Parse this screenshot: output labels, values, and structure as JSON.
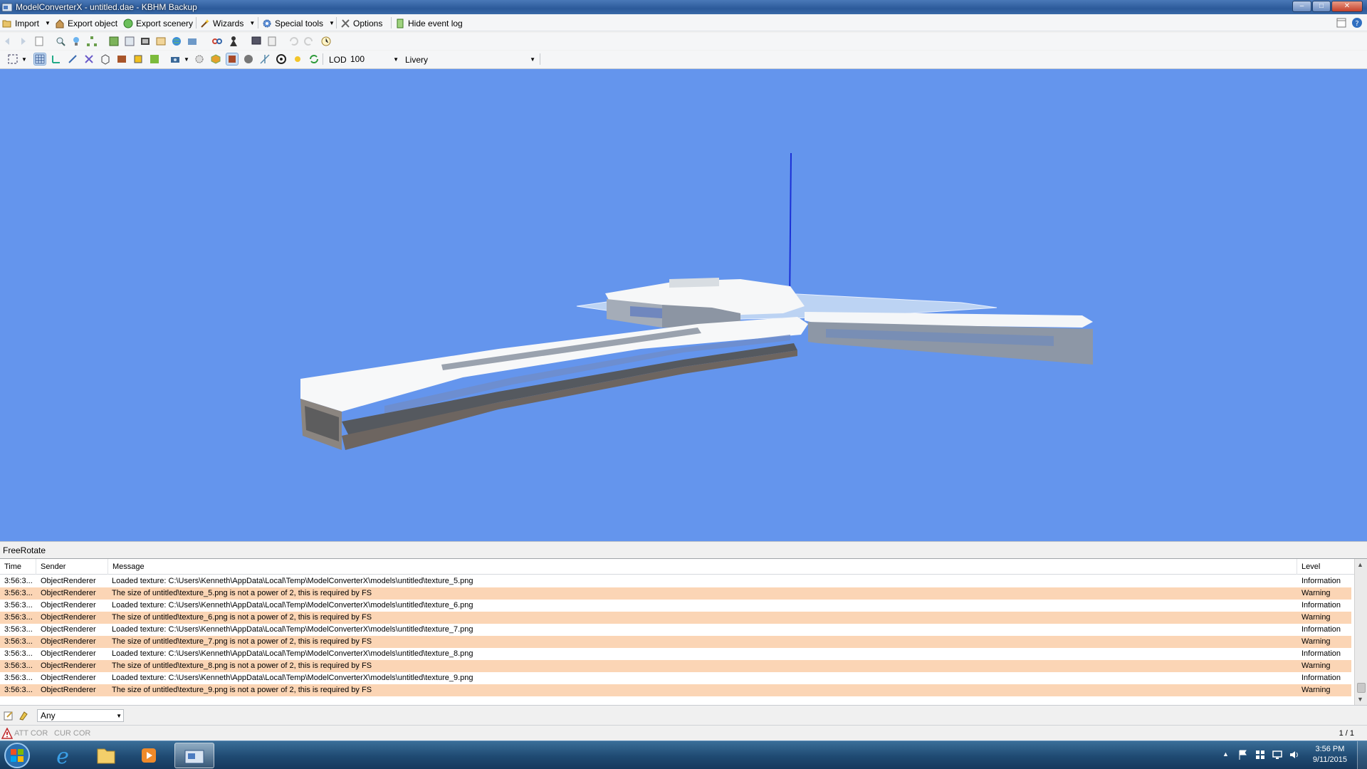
{
  "window": {
    "title": "ModelConverterX - untitled.dae - KBHM Backup",
    "buttons": {
      "minimize": "–",
      "maximize": "□",
      "close": "✕"
    }
  },
  "menu": {
    "import": "Import",
    "export_object": "Export object",
    "export_scenery": "Export scenery",
    "wizards": "Wizards",
    "special_tools": "Special tools",
    "options": "Options",
    "hide_event_log": "Hide event log"
  },
  "toolbar": {
    "lod_label": "LOD",
    "lod_value": "100",
    "livery_label": "Livery",
    "livery_value": ""
  },
  "viewport": {
    "mode": "FreeRotate",
    "background": "#6495ed"
  },
  "log": {
    "columns": {
      "time": "Time",
      "sender": "Sender",
      "message": "Message",
      "level": "Level"
    },
    "rows": [
      {
        "time": "3:56:3...",
        "sender": "ObjectRenderer",
        "message": "Loaded texture: C:\\Users\\Kenneth\\AppData\\Local\\Temp\\ModelConverterX\\models\\untitled\\texture_5.png",
        "level": "Information"
      },
      {
        "time": "3:56:3...",
        "sender": "ObjectRenderer",
        "message": "The size of untitled\\texture_5.png is not a power of 2, this is required by FS",
        "level": "Warning"
      },
      {
        "time": "3:56:3...",
        "sender": "ObjectRenderer",
        "message": "Loaded texture: C:\\Users\\Kenneth\\AppData\\Local\\Temp\\ModelConverterX\\models\\untitled\\texture_6.png",
        "level": "Information"
      },
      {
        "time": "3:56:3...",
        "sender": "ObjectRenderer",
        "message": "The size of untitled\\texture_6.png is not a power of 2, this is required by FS",
        "level": "Warning"
      },
      {
        "time": "3:56:3...",
        "sender": "ObjectRenderer",
        "message": "Loaded texture: C:\\Users\\Kenneth\\AppData\\Local\\Temp\\ModelConverterX\\models\\untitled\\texture_7.png",
        "level": "Information"
      },
      {
        "time": "3:56:3...",
        "sender": "ObjectRenderer",
        "message": "The size of untitled\\texture_7.png is not a power of 2, this is required by FS",
        "level": "Warning"
      },
      {
        "time": "3:56:3...",
        "sender": "ObjectRenderer",
        "message": "Loaded texture: C:\\Users\\Kenneth\\AppData\\Local\\Temp\\ModelConverterX\\models\\untitled\\texture_8.png",
        "level": "Information"
      },
      {
        "time": "3:56:3...",
        "sender": "ObjectRenderer",
        "message": "The size of untitled\\texture_8.png is not a power of 2, this is required by FS",
        "level": "Warning"
      },
      {
        "time": "3:56:3...",
        "sender": "ObjectRenderer",
        "message": "Loaded texture: C:\\Users\\Kenneth\\AppData\\Local\\Temp\\ModelConverterX\\models\\untitled\\texture_9.png",
        "level": "Information"
      },
      {
        "time": "3:56:3...",
        "sender": "ObjectRenderer",
        "message": "The size of untitled\\texture_9.png is not a power of 2, this is required by FS",
        "level": "Warning"
      }
    ],
    "warning_color": "#fbd5b5"
  },
  "filter": {
    "value": "Any"
  },
  "status": {
    "att": "ATT COR",
    "cur": "CUR COR",
    "pager": "1 / 1"
  },
  "taskbar": {
    "time": "3:56 PM",
    "date": "9/11/2015"
  }
}
